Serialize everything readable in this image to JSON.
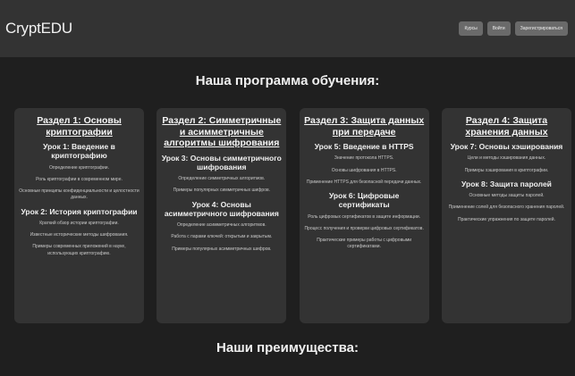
{
  "header": {
    "brand": "CryptEDU",
    "buttons": [
      {
        "label": "Курсы",
        "name": "courses-button"
      },
      {
        "label": "Войти",
        "name": "login-button"
      },
      {
        "label": "Зарегистрироваться",
        "name": "register-button"
      }
    ]
  },
  "program": {
    "title": "Наша программа обучения:",
    "sections": [
      {
        "title": "Раздел 1: Основы криптографии",
        "lessons": [
          {
            "title": "Урок 1: Введение в криптографию",
            "items": [
              "Определение криптографии.",
              "Роль криптографии в современном мире.",
              "Основные принципы конфиденциальности и целостности данных."
            ]
          },
          {
            "title": "Урок 2: История криптографии",
            "items": [
              "Краткий обзор истории криптографии.",
              "Известные исторические методы шифрования.",
              "Примеры современных приложений в науке, использующих криптографию."
            ]
          }
        ]
      },
      {
        "title": "Раздел 2: Симметричные и асимметричные алгоритмы шифрования",
        "lessons": [
          {
            "title": "Урок 3: Основы симметричного шифрования",
            "items": [
              "Определение симметричных алгоритмов.",
              "Примеры популярных симметричных шифров."
            ]
          },
          {
            "title": "Урок 4: Основы асимметричного шифрования",
            "items": [
              "Определение асимметричных алгоритмов.",
              "Работа с парами ключей: открытым и закрытым.",
              "Примеры популярных асимметричных шифров."
            ]
          }
        ]
      },
      {
        "title": "Раздел 3: Защита данных при передаче",
        "lessons": [
          {
            "title": "Урок 5: Введение в HTTPS",
            "items": [
              "Значение протокола HTTPS.",
              "Основы шифрования в HTTPS.",
              "Применение HTTPS для безопасной передачи данных."
            ]
          },
          {
            "title": "Урок 6: Цифровые сертификаты",
            "items": [
              "Роль цифровых сертификатов в защите информации.",
              "Процесс получения и проверки цифровых сертификатов.",
              "Практические примеры работы с цифровыми сертификатами."
            ]
          }
        ]
      },
      {
        "title": "Раздел 4: Защита хранения данных",
        "lessons": [
          {
            "title": "Урок 7: Основы хэширования",
            "items": [
              "Цели и методы хэширования данных.",
              "Примеры хэширования в криптографии."
            ]
          },
          {
            "title": "Урок 8: Защита паролей",
            "items": [
              "Основные методы защиты паролей.",
              "Применение солей для безопасного хранения паролей.",
              "Практические упражнения по защите паролей."
            ]
          }
        ]
      }
    ]
  },
  "advantages": {
    "title": "Наши преимущества:"
  }
}
